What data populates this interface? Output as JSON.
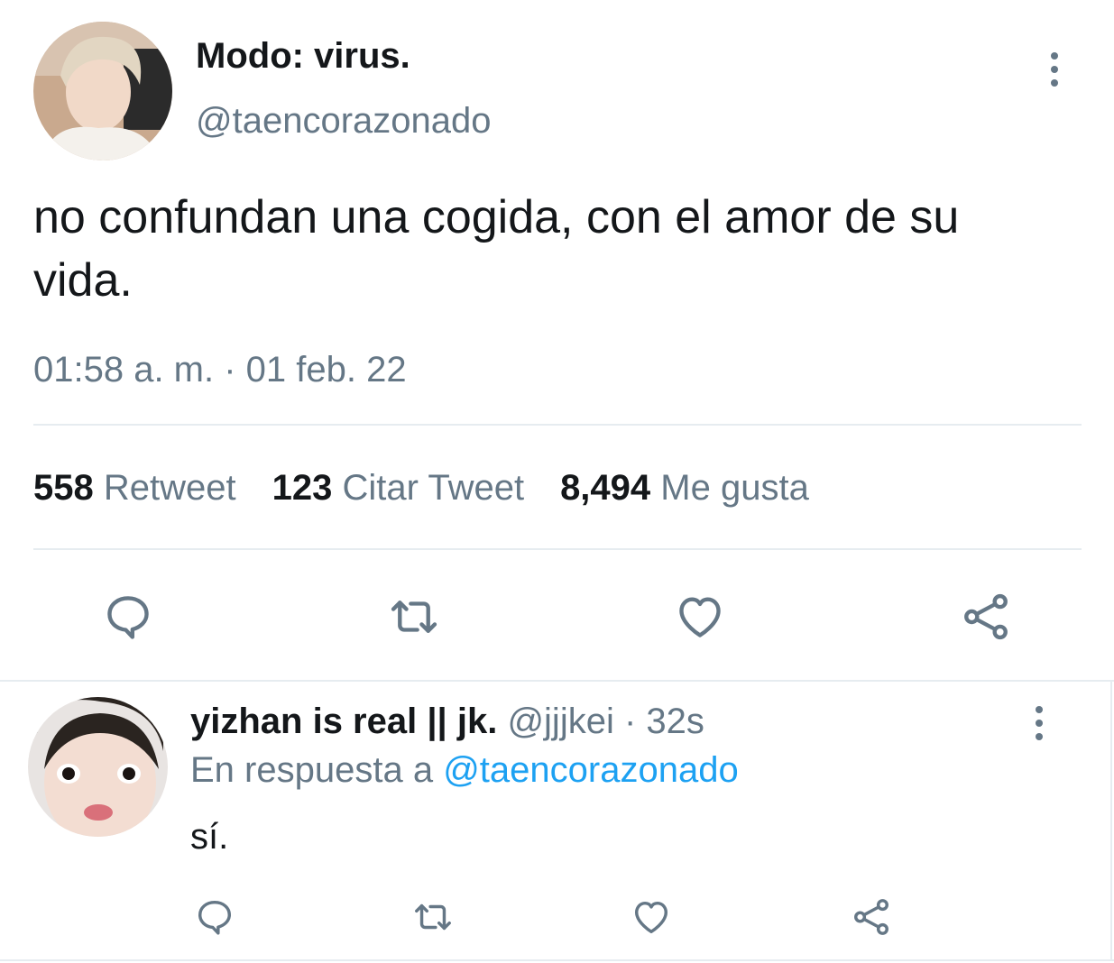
{
  "main_tweet": {
    "display_name": "Modo: virus.",
    "handle": "@taencorazonado",
    "text": "no confundan una cogida, con el amor de su vida.",
    "timestamp": "01:58 a. m. · 01 feb. 22",
    "stats": {
      "retweets_count": "558",
      "retweets_label": "Retweet",
      "quotes_count": "123",
      "quotes_label": "Citar Tweet",
      "likes_count": "8,494",
      "likes_label": "Me gusta"
    },
    "actions": [
      "reply-icon",
      "retweet-icon",
      "like-icon",
      "share-icon"
    ]
  },
  "reply": {
    "display_name": "yizhan is real || jk.",
    "handle": "@jjjkei",
    "time": "· 32s",
    "in_reply_prefix": "En respuesta a",
    "in_reply_handle": "@taencorazonado",
    "text": "sí.",
    "actions": [
      "reply-icon",
      "retweet-icon",
      "like-icon",
      "share-icon"
    ]
  },
  "colors": {
    "text": "#14171a",
    "muted": "#657786",
    "link": "#1da1f2",
    "divider": "#e6ecf0"
  }
}
